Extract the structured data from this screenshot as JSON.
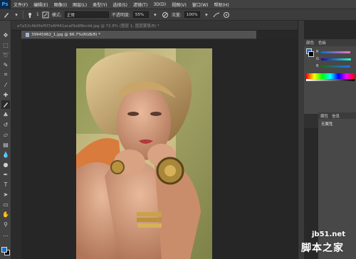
{
  "app": {
    "logo": "Ps"
  },
  "menu": [
    "文件(F)",
    "编辑(E)",
    "图像(I)",
    "图层(L)",
    "类型(Y)",
    "选择(S)",
    "滤镜(T)",
    "3D(D)",
    "视图(V)",
    "窗口(W)",
    "帮助(H)"
  ],
  "options": {
    "size_value": "1",
    "mode_label": "模式:",
    "mode_value": "正常",
    "opacity_label": "不透明度:",
    "opacity_value": "55%",
    "flow_label": "流量:",
    "flow_value": "100%"
  },
  "tabs": {
    "back_tab": "a7a52c4b0fef5f7e6f441acaf9a98bcdd.jpg @ 72.8% (图层 1, 图层蒙版/8) *",
    "front_tab": "39945962_1.jpg @ 66.7%(RGB/8) *"
  },
  "panels": {
    "color_tabs": [
      "颜色",
      "色板"
    ],
    "props_tabs": [
      "属性",
      "信息"
    ],
    "props_title": "无属性",
    "slider_labels": [
      "R",
      "G",
      "B"
    ]
  },
  "colors": {
    "foreground": "#1e6fc4",
    "background": "#000000",
    "ui_dark": "#282828",
    "ui_panel": "#484848"
  },
  "watermark": {
    "url": "jb51.net",
    "name": "脚本之家"
  }
}
